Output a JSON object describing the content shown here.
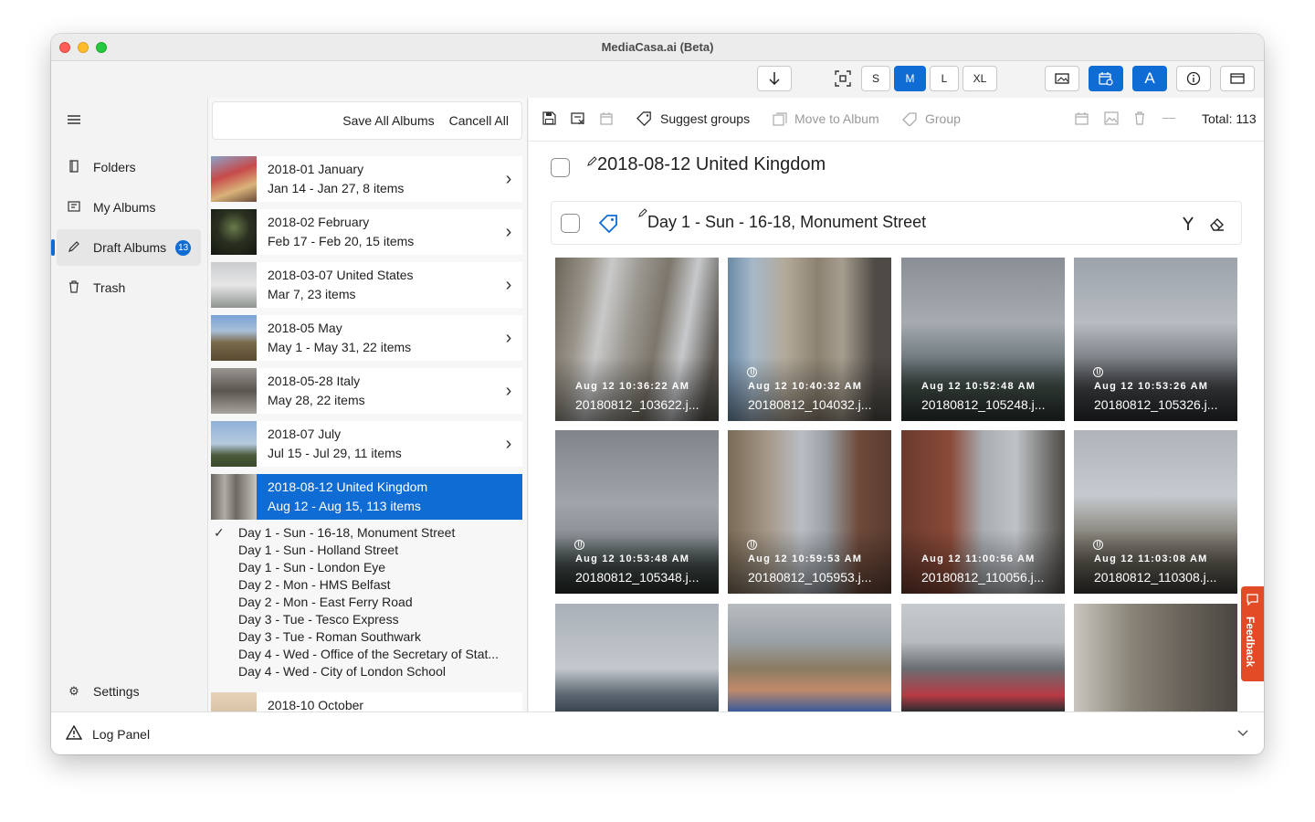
{
  "window": {
    "title": "MediaCasa.ai (Beta)"
  },
  "toolbar": {
    "download_icon": "arrow-down-icon",
    "fit_icon": "fit-screen-icon",
    "sizes": [
      "S",
      "M",
      "L",
      "XL"
    ],
    "selected_size": "M",
    "font_label": "A"
  },
  "sidebar": {
    "items": [
      {
        "label": "Folders",
        "icon": "folder-icon"
      },
      {
        "label": "My Albums",
        "icon": "album-icon"
      },
      {
        "label": "Draft Albums",
        "icon": "pencil-icon",
        "badge": "13"
      },
      {
        "label": "Trash",
        "icon": "trash-icon"
      }
    ],
    "settings_label": "Settings"
  },
  "albums_panel": {
    "save_all": "Save All Albums",
    "cancel_all": "Cancell All",
    "albums": [
      {
        "title": "2018-01  January",
        "subtitle": "Jan 14 - Jan 27, 8 items"
      },
      {
        "title": "2018-02  February",
        "subtitle": "Feb 17 - Feb 20, 15 items"
      },
      {
        "title": "2018-03-07  United States",
        "subtitle": "Mar 7, 23 items"
      },
      {
        "title": "2018-05  May",
        "subtitle": "May 1 - May 31, 22 items"
      },
      {
        "title": "2018-05-28  Italy",
        "subtitle": "May 28, 22 items"
      },
      {
        "title": "2018-07  July",
        "subtitle": "Jul 15 - Jul 29, 11 items"
      },
      {
        "title": "2018-08-12  United Kingdom",
        "subtitle": "Aug 12 - Aug 15, 113 items"
      }
    ],
    "days": [
      "Day 1 - Sun - 16-18, Monument Street",
      "Day 1 - Sun - Holland Street",
      "Day 1 - Sun - London Eye",
      "Day 2 - Mon - HMS Belfast",
      "Day 2 - Mon - East Ferry Road",
      "Day 3 - Tue - Tesco Express",
      "Day 3 - Tue - Roman Southwark",
      "Day 4 - Wed - Office of the Secretary of Stat...",
      "Day 4 - Wed - City of London School"
    ],
    "next_album": "2018-10  October"
  },
  "main": {
    "suggest_groups": "Suggest groups",
    "move_to_album": "Move to Album",
    "group": "Group",
    "total": "Total: 113",
    "group_title": "2018-08-12 United Kingdom",
    "subgroup_title": "Day 1 - Sun - 16-18, Monument Street",
    "photos": [
      {
        "time": "Aug 12 10:36:22 AM",
        "file": "20180812_103622.j...",
        "geo": false
      },
      {
        "time": "Aug 12 10:40:32 AM",
        "file": "20180812_104032.j...",
        "geo": true
      },
      {
        "time": "Aug 12 10:52:48 AM",
        "file": "20180812_105248.j...",
        "geo": false
      },
      {
        "time": "Aug 12 10:53:26 AM",
        "file": "20180812_105326.j...",
        "geo": true
      },
      {
        "time": "Aug 12 10:53:48 AM",
        "file": "20180812_105348.j...",
        "geo": true
      },
      {
        "time": "Aug 12 10:59:53 AM",
        "file": "20180812_105953.j...",
        "geo": true
      },
      {
        "time": "Aug 12 11:00:56 AM",
        "file": "20180812_110056.j...",
        "geo": false
      },
      {
        "time": "Aug 12 11:03:08 AM",
        "file": "20180812_110308.j...",
        "geo": true
      }
    ]
  },
  "log_panel": {
    "label": "Log Panel"
  },
  "feedback": {
    "label": "Feedback"
  },
  "colors": {
    "accent": "#0f6cd4",
    "feedback": "#e24b26"
  }
}
